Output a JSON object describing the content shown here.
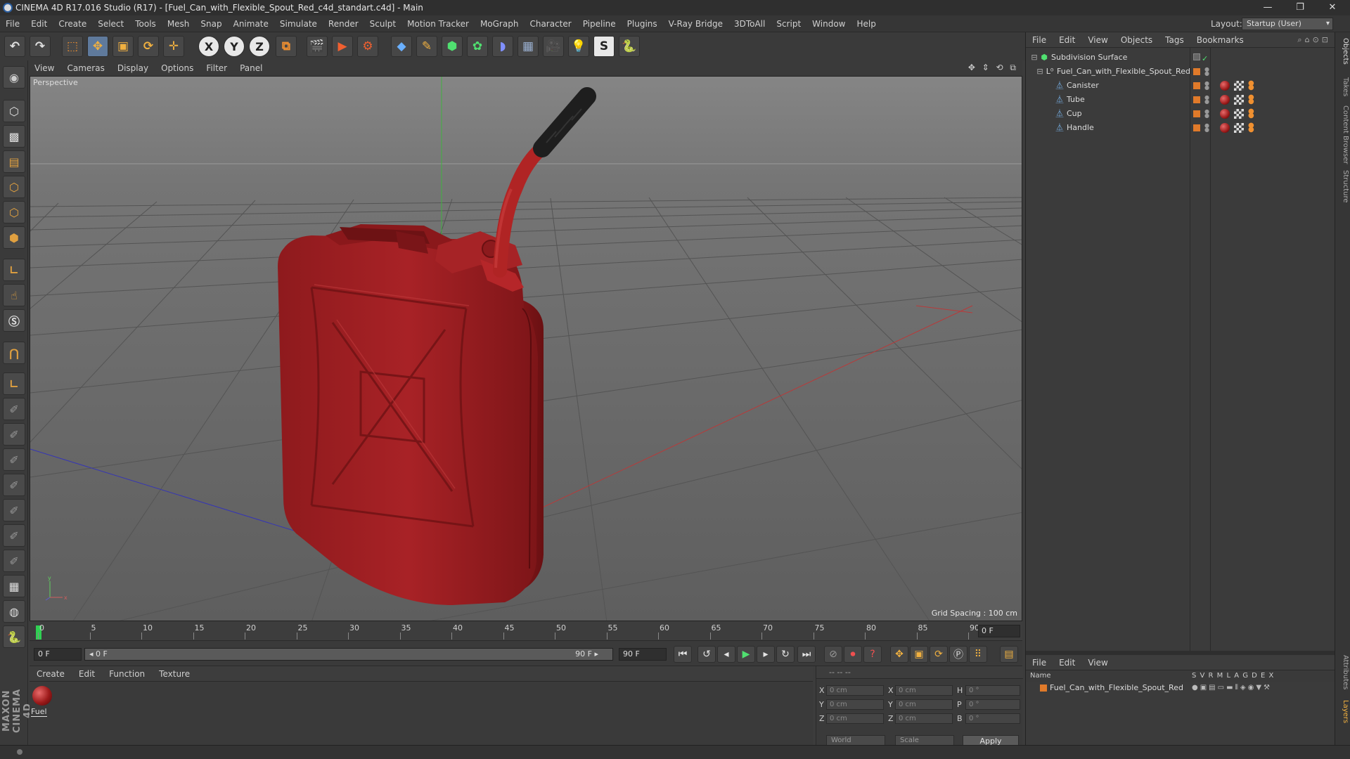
{
  "window": {
    "title": "CINEMA 4D R17.016 Studio (R17) - [Fuel_Can_with_Flexible_Spout_Red_c4d_standart.c4d] - Main",
    "minimize": "—",
    "restore": "❐",
    "close": "✕"
  },
  "menu": [
    "File",
    "Edit",
    "Create",
    "Select",
    "Tools",
    "Mesh",
    "Snap",
    "Animate",
    "Simulate",
    "Render",
    "Sculpt",
    "Motion Tracker",
    "MoGraph",
    "Character",
    "Pipeline",
    "Plugins",
    "V-Ray Bridge",
    "3DToAll",
    "Script",
    "Window",
    "Help"
  ],
  "layout": {
    "label": "Layout:",
    "value": "Startup (User)"
  },
  "toolbar": {
    "axis_x": "X",
    "axis_y": "Y",
    "axis_z": "Z"
  },
  "viewport": {
    "menu": [
      "View",
      "Cameras",
      "Display",
      "Options",
      "Filter",
      "Panel"
    ],
    "label": "Perspective",
    "grid_spacing": "Grid Spacing : 100 cm",
    "nav_icons": "✥ ⇕ ⟲ ⧉",
    "colors": {
      "body": "#9b1f22",
      "spout_red": "#b02424",
      "cap": "#1e1e1e",
      "bg": "#6a6a6a"
    }
  },
  "timeline": {
    "ticks": [
      "0",
      "5",
      "10",
      "15",
      "20",
      "25",
      "30",
      "35",
      "40",
      "45",
      "50",
      "55",
      "60",
      "65",
      "70",
      "75",
      "80",
      "85",
      "90"
    ],
    "frame_end": "0 F"
  },
  "transport": {
    "start_field": "0 F",
    "slider_left": "◂ 0 F",
    "slider_right": "90 F ▸",
    "end_field": "90 F"
  },
  "materials": {
    "menu": [
      "Create",
      "Edit",
      "Function",
      "Texture"
    ],
    "items": [
      {
        "name": "Fuel"
      }
    ]
  },
  "coords": {
    "header": "--            --            --",
    "rows": [
      {
        "l1": "X",
        "v1": "0 cm",
        "l2": "X",
        "v2": "0 cm",
        "l3": "H",
        "v3": "0 °"
      },
      {
        "l1": "Y",
        "v1": "0 cm",
        "l2": "Y",
        "v2": "0 cm",
        "l3": "P",
        "v3": "0 °"
      },
      {
        "l1": "Z",
        "v1": "0 cm",
        "l2": "Z",
        "v2": "0 cm",
        "l3": "B",
        "v3": "0 °"
      }
    ],
    "world": "World",
    "scale": "Scale",
    "apply": "Apply"
  },
  "objects": {
    "menu": [
      "File",
      "Edit",
      "View",
      "Objects",
      "Tags",
      "Bookmarks"
    ],
    "tree": [
      {
        "name": "Subdivision Surface"
      },
      {
        "name": "Fuel_Can_with_Flexible_Spout_Red"
      },
      {
        "name": "Canister"
      },
      {
        "name": "Tube"
      },
      {
        "name": "Cup"
      },
      {
        "name": "Handle"
      }
    ]
  },
  "layers": {
    "menu": [
      "File",
      "Edit",
      "View"
    ],
    "header": {
      "name": "Name",
      "cols": "S  V  R  M  L  A  G  D  E  X"
    },
    "row": "Fuel_Can_with_Flexible_Spout_Red"
  },
  "side_tabs": [
    "Objects",
    "Takes",
    "Content Browser",
    "Structure",
    "Attributes",
    "Layers"
  ],
  "brand": "MAXON CINEMA 4D"
}
